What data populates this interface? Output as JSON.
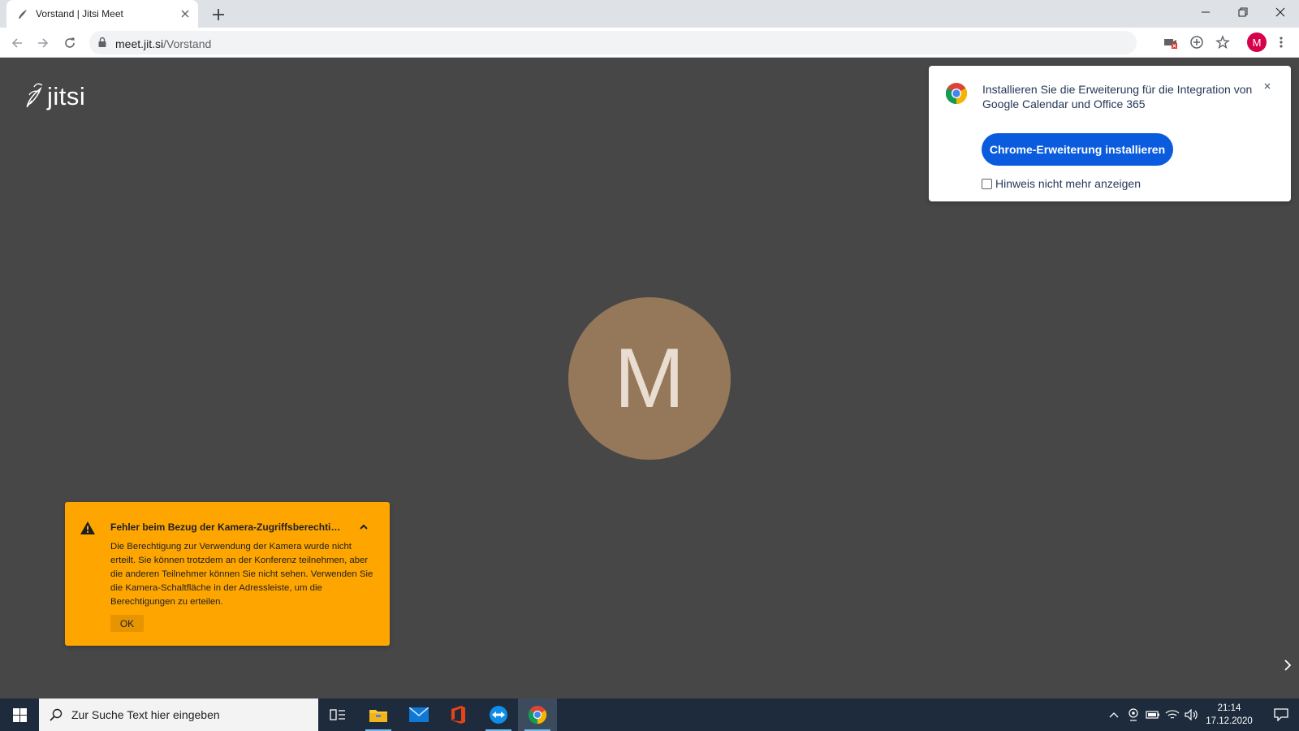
{
  "browser": {
    "tab_title": "Vorstand | Jitsi Meet",
    "url_host": "meet.jit.si",
    "url_path": "/Vorstand",
    "profile_initial": "M"
  },
  "jitsi": {
    "logo_text": "jitsi",
    "avatar_initial": "M",
    "colors": {
      "background": "#474747",
      "avatar": "#957859"
    }
  },
  "extension_notice": {
    "message": "Installieren Sie die Erweiterung für die Integration von Google Calendar und Office 365",
    "button_label": "Chrome-Erweiterung installieren",
    "checkbox_label": "Hinweis nicht mehr anzeigen",
    "colors": {
      "button": "#0a5bde"
    }
  },
  "camera_warning": {
    "title": "Fehler beim Bezug der Kamera-Zugriffsberechti…",
    "body": "Die Berechtigung zur Verwendung der Kamera wurde nicht erteilt. Sie können trotzdem an der Konferenz teilnehmen, aber die anderen Teilnehmer können Sie nicht sehen. Verwenden Sie die Kamera-Schaltfläche in der Adressleiste, um die Berechtigungen zu erteilen.",
    "ok_label": "OK",
    "colors": {
      "background": "#ffa500"
    }
  },
  "taskbar": {
    "search_placeholder": "Zur Suche Text hier eingeben",
    "time": "21:14",
    "date": "17.12.2020",
    "apps": [
      "task-view-icon",
      "file-explorer-icon",
      "mail-icon",
      "office-icon",
      "teamviewer-icon",
      "chrome-icon"
    ]
  }
}
